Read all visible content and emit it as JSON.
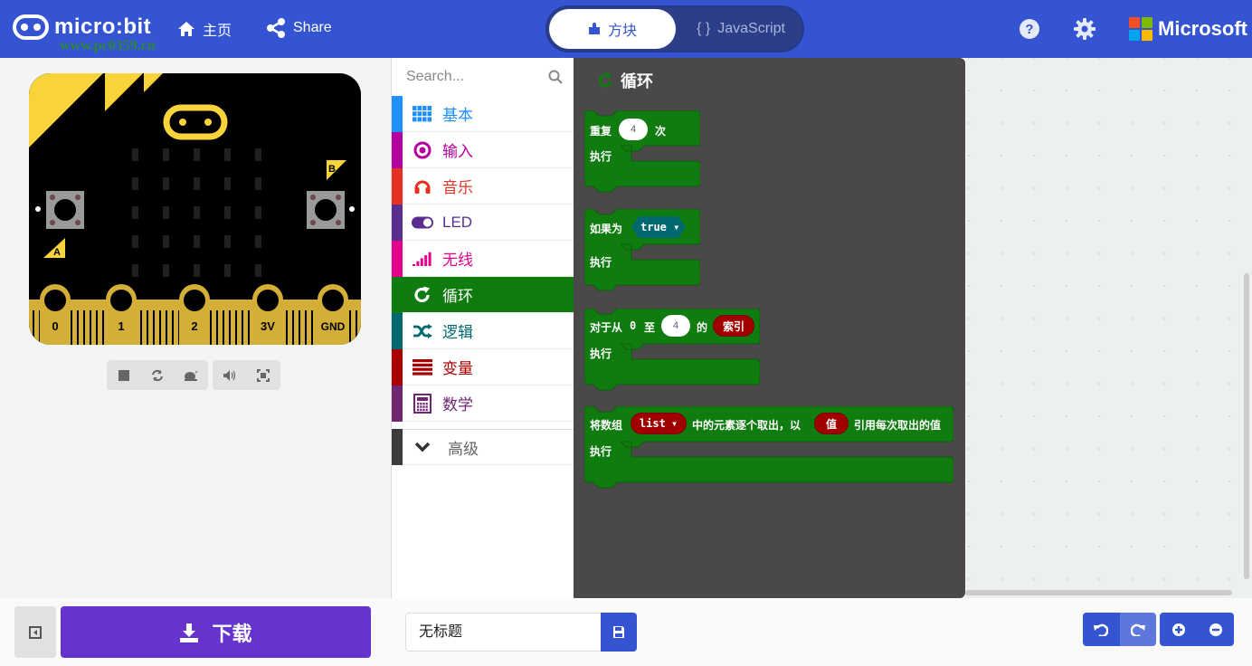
{
  "header": {
    "logo_text": "micro:bit",
    "home_label": "主页",
    "share_label": "Share",
    "toggle": {
      "blocks_label": "方块",
      "js_label": "JavaScript",
      "js_icon": "{ }",
      "active": "blocks"
    },
    "help_icon": "help-icon",
    "settings_icon": "gear-icon",
    "brand_label": "Microsoft",
    "watermark": "www.pc0359.cn"
  },
  "simulator": {
    "pins": [
      "0",
      "1",
      "2",
      "3V",
      "GND"
    ],
    "button_a": "A",
    "button_b": "B",
    "controls": [
      "stop",
      "restart",
      "slow-mo",
      "mute",
      "fullscreen"
    ]
  },
  "toolbox": {
    "search_placeholder": "Search...",
    "categories": [
      {
        "label": "基本",
        "color": "#1e90ff",
        "icon": "grid-icon"
      },
      {
        "label": "输入",
        "color": "#b4009e",
        "icon": "target-icon"
      },
      {
        "label": "音乐",
        "color": "#e63022",
        "icon": "headphones-icon"
      },
      {
        "label": "LED",
        "color": "#5c2d91",
        "icon": "toggle-icon"
      },
      {
        "label": "无线",
        "color": "#e3008c",
        "icon": "signal-icon"
      },
      {
        "label": "循环",
        "color": "#107c10",
        "icon": "refresh-icon",
        "selected": true
      },
      {
        "label": "逻辑",
        "color": "#006970",
        "icon": "shuffle-icon"
      },
      {
        "label": "变量",
        "color": "#a80000",
        "icon": "list-icon"
      },
      {
        "label": "数学",
        "color": "#712672",
        "icon": "calculator-icon"
      }
    ],
    "advanced_label": "高级"
  },
  "flyout": {
    "title": "循环",
    "blocks": [
      {
        "prefix": "重复",
        "value": "4",
        "suffix": "次",
        "do": "执行"
      },
      {
        "prefix": "如果为",
        "value": "true",
        "do": "执行"
      },
      {
        "prefix": "对于从",
        "from": "0",
        "mid": "至",
        "to": "4",
        "of": "的",
        "var": "索引",
        "do": "执行"
      },
      {
        "prefix": "将数组",
        "list": "list",
        "mid": "中的元素逐个取出，以",
        "var": "值",
        "suffix": "引用每次取出的值",
        "do": "执行"
      }
    ]
  },
  "footer": {
    "download_label": "下载",
    "project_name": "无标题"
  },
  "colors": {
    "header": "#3454d1",
    "loops": "#107c10",
    "download": "#6633cc",
    "flyout": "#4a4848"
  }
}
